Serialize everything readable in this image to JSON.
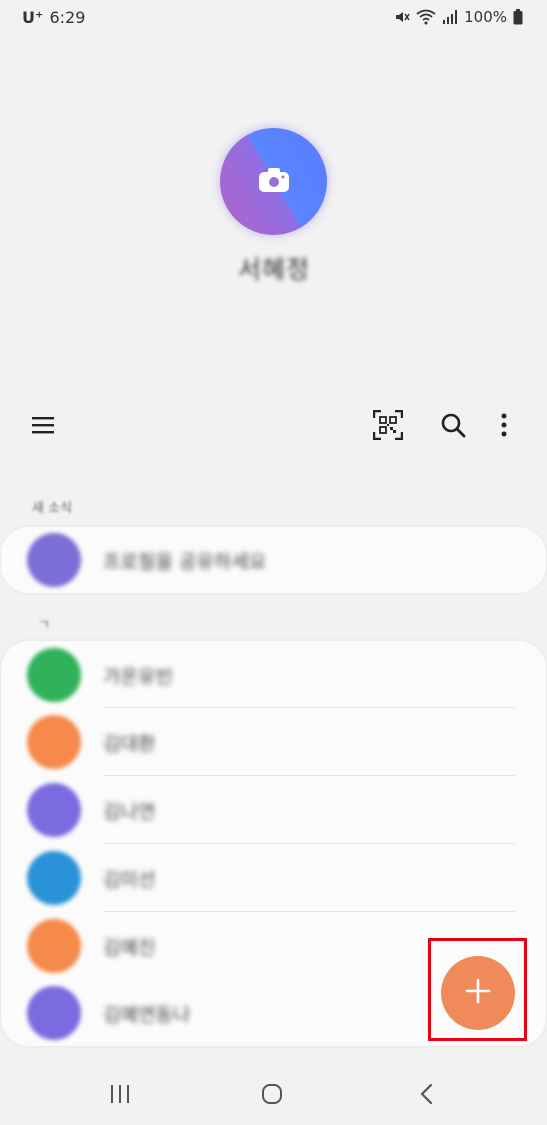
{
  "status_bar": {
    "carrier": "U⁺",
    "time": "6:29",
    "battery": "100%",
    "icons": [
      "mute-icon",
      "wifi-icon",
      "signal-icon",
      "battery-icon"
    ]
  },
  "profile": {
    "name": "서혜정",
    "avatar_icon": "camera-icon"
  },
  "toolbar": {
    "icons": [
      "menu-icon",
      "qr-code-icon",
      "search-icon",
      "more-options-icon"
    ]
  },
  "new_section": {
    "label": "새 소식",
    "items": [
      {
        "text": "프로필을 공유하세요",
        "avatar_color": "#7a6fd6"
      }
    ]
  },
  "contacts_section": {
    "label": "ㄱ",
    "items": [
      {
        "name": "가온유빈",
        "avatar_color": "#2fb25a"
      },
      {
        "name": "김대환",
        "avatar_color": "#f58a4a"
      },
      {
        "name": "김나연",
        "avatar_color": "#7b6be0"
      },
      {
        "name": "김미선",
        "avatar_color": "#2a93d8"
      },
      {
        "name": "김예진",
        "avatar_color": "#f58a4a"
      },
      {
        "name": "김예연동나",
        "avatar_color": "#7b6be0"
      }
    ]
  },
  "fab": {
    "label": "+",
    "color": "#ef8a5a"
  },
  "nav_bar": {
    "icons": [
      "recent-apps-icon",
      "home-icon",
      "back-icon"
    ]
  }
}
